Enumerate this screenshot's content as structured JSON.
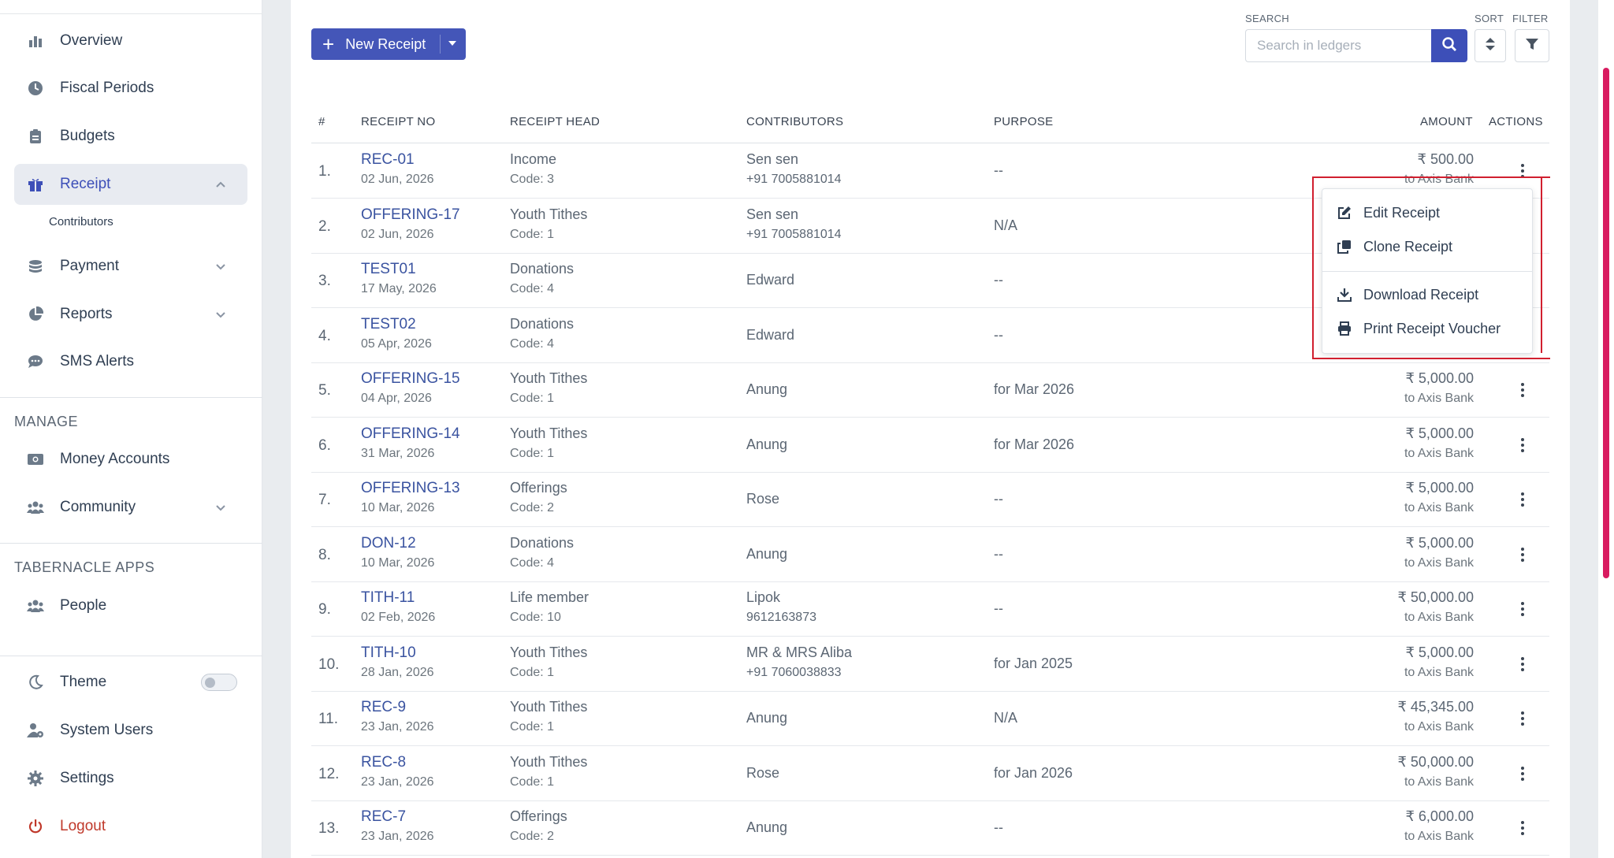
{
  "sidebar": {
    "items": [
      {
        "label": "Overview",
        "icon": "bar-chart-icon"
      },
      {
        "label": "Fiscal Periods",
        "icon": "clock-icon"
      },
      {
        "label": "Budgets",
        "icon": "clipboard-icon"
      },
      {
        "label": "Receipt",
        "icon": "gift-icon",
        "active": true
      },
      {
        "label": "Payment",
        "icon": "coins-icon"
      },
      {
        "label": "Reports",
        "icon": "pie-chart-icon"
      },
      {
        "label": "SMS Alerts",
        "icon": "chat-icon"
      }
    ],
    "sub_contributors": "Contributors",
    "manage_title": "MANAGE",
    "manage_items": [
      {
        "label": "Money Accounts",
        "icon": "money-icon"
      },
      {
        "label": "Community",
        "icon": "users-icon"
      }
    ],
    "apps_title": "TABERNACLE APPS",
    "apps_items": [
      {
        "label": "People",
        "icon": "users-icon"
      }
    ],
    "bottom_items": [
      {
        "label": "Theme",
        "icon": "moon-icon"
      },
      {
        "label": "System Users",
        "icon": "user-gear-icon"
      },
      {
        "label": "Settings",
        "icon": "gear-icon"
      },
      {
        "label": "Logout",
        "icon": "power-icon"
      }
    ]
  },
  "toolbar": {
    "new_receipt": "New Receipt",
    "search_label": "SEARCH",
    "search_placeholder": "Search in ledgers",
    "sort_label": "SORT",
    "filter_label": "FILTER"
  },
  "table": {
    "headers": {
      "num": "#",
      "receipt_no": "RECEIPT NO",
      "receipt_head": "RECEIPT HEAD",
      "contributors": "CONTRIBUTORS",
      "purpose": "PURPOSE",
      "amount": "AMOUNT",
      "actions": "ACTIONS"
    },
    "rows": [
      {
        "idx": "1.",
        "no": "REC-01",
        "date": "02 Jun, 2026",
        "head": "Income",
        "code": "Code: 3",
        "contrib": "Sen sen",
        "phone": "+91 7005881014",
        "purpose": "--",
        "amount": "₹ 500.00",
        "bank": "to Axis Bank"
      },
      {
        "idx": "2.",
        "no": "OFFERING-17",
        "date": "02 Jun, 2026",
        "head": "Youth Tithes",
        "code": "Code: 1",
        "contrib": "Sen sen",
        "phone": "+91 7005881014",
        "purpose": "N/A",
        "amount": "",
        "bank": ""
      },
      {
        "idx": "3.",
        "no": "TEST01",
        "date": "17 May, 2026",
        "head": "Donations",
        "code": "Code: 4",
        "contrib": "Edward",
        "phone": "",
        "purpose": "--",
        "amount": "",
        "bank": ""
      },
      {
        "idx": "4.",
        "no": "TEST02",
        "date": "05 Apr, 2026",
        "head": "Donations",
        "code": "Code: 4",
        "contrib": "Edward",
        "phone": "",
        "purpose": "--",
        "amount": "",
        "bank": ""
      },
      {
        "idx": "5.",
        "no": "OFFERING-15",
        "date": "04 Apr, 2026",
        "head": "Youth Tithes",
        "code": "Code: 1",
        "contrib": "Anung",
        "phone": "",
        "purpose": "for Mar 2026",
        "amount": "₹ 5,000.00",
        "bank": "to Axis Bank"
      },
      {
        "idx": "6.",
        "no": "OFFERING-14",
        "date": "31 Mar, 2026",
        "head": "Youth Tithes",
        "code": "Code: 1",
        "contrib": "Anung",
        "phone": "",
        "purpose": "for Mar 2026",
        "amount": "₹ 5,000.00",
        "bank": "to Axis Bank"
      },
      {
        "idx": "7.",
        "no": "OFFERING-13",
        "date": "10 Mar, 2026",
        "head": "Offerings",
        "code": "Code: 2",
        "contrib": "Rose",
        "phone": "",
        "purpose": "--",
        "amount": "₹ 5,000.00",
        "bank": "to Axis Bank"
      },
      {
        "idx": "8.",
        "no": "DON-12",
        "date": "10 Mar, 2026",
        "head": "Donations",
        "code": "Code: 4",
        "contrib": "Anung",
        "phone": "",
        "purpose": "--",
        "amount": "₹ 5,000.00",
        "bank": "to Axis Bank"
      },
      {
        "idx": "9.",
        "no": "TITH-11",
        "date": "02 Feb, 2026",
        "head": "Life member",
        "code": "Code: 10",
        "contrib": "Lipok",
        "phone": "9612163873",
        "purpose": "--",
        "amount": "₹ 50,000.00",
        "bank": "to Axis Bank"
      },
      {
        "idx": "10.",
        "no": "TITH-10",
        "date": "28 Jan, 2026",
        "head": "Youth Tithes",
        "code": "Code: 1",
        "contrib": "MR & MRS Aliba",
        "phone": "+91 7060038833",
        "purpose": "for Jan 2025",
        "amount": "₹ 5,000.00",
        "bank": "to Axis Bank"
      },
      {
        "idx": "11.",
        "no": "REC-9",
        "date": "23 Jan, 2026",
        "head": "Youth Tithes",
        "code": "Code: 1",
        "contrib": "Anung",
        "phone": "",
        "purpose": "N/A",
        "amount": "₹ 45,345.00",
        "bank": "to Axis Bank"
      },
      {
        "idx": "12.",
        "no": "REC-8",
        "date": "23 Jan, 2026",
        "head": "Youth Tithes",
        "code": "Code: 1",
        "contrib": "Rose",
        "phone": "",
        "purpose": "for Jan 2026",
        "amount": "₹ 50,000.00",
        "bank": "to Axis Bank"
      },
      {
        "idx": "13.",
        "no": "REC-7",
        "date": "23 Jan, 2026",
        "head": "Offerings",
        "code": "Code: 2",
        "contrib": "Anung",
        "phone": "",
        "purpose": "--",
        "amount": "₹ 6,000.00",
        "bank": "to Axis Bank"
      }
    ]
  },
  "dropdown": {
    "edit": "Edit Receipt",
    "clone": "Clone Receipt",
    "download": "Download Receipt",
    "print": "Print Receipt Voucher"
  },
  "colors": {
    "primary": "#4456b8",
    "highlight": "#d11f2f",
    "scrollbar": "#d81b60"
  }
}
